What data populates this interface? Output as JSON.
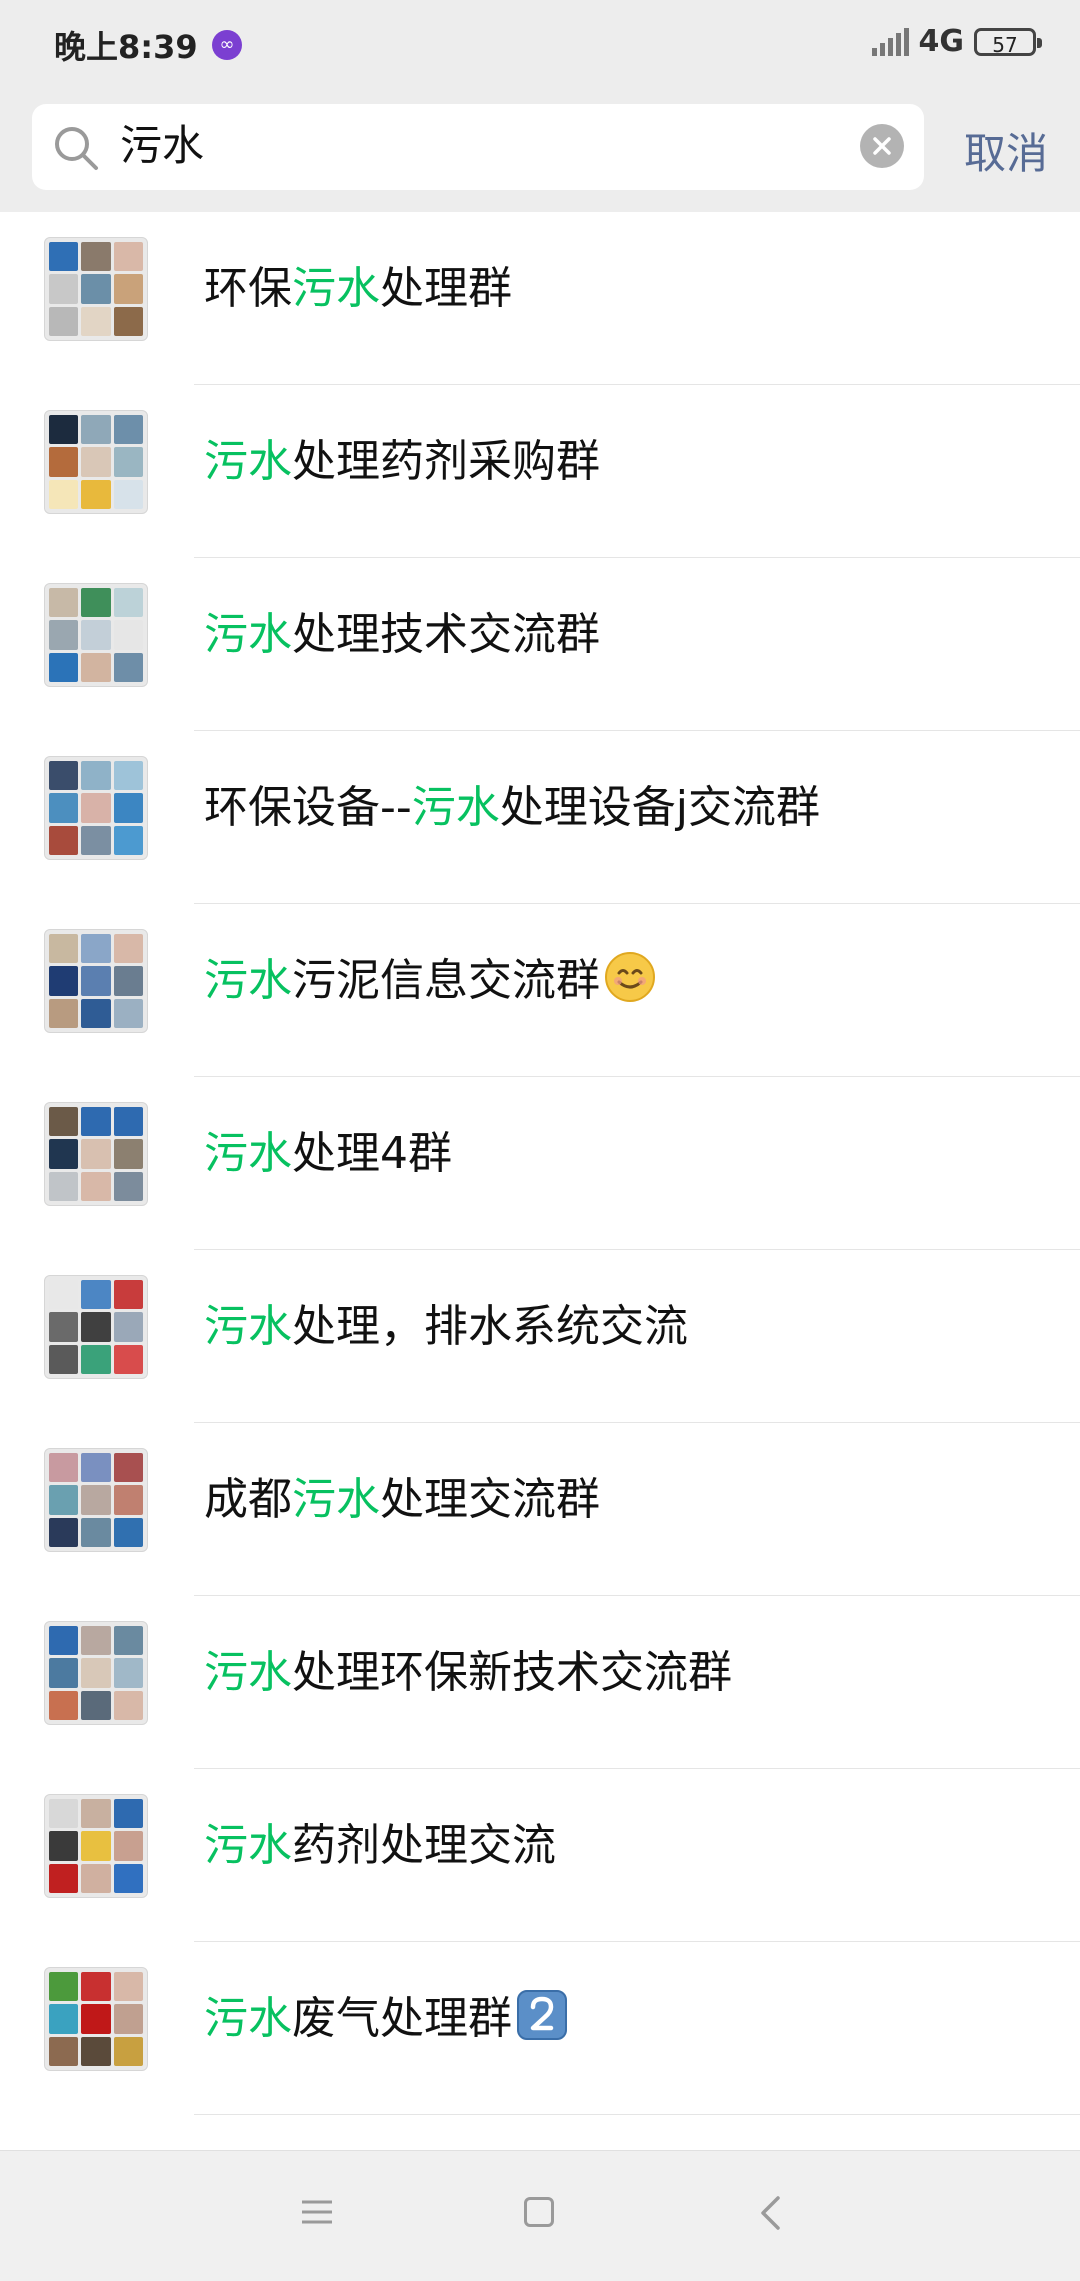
{
  "status_bar": {
    "time": "晚上8:39",
    "app_icon": "infinity-icon",
    "network": "4G",
    "battery": "57"
  },
  "search": {
    "query": "污水",
    "cancel_label": "取消"
  },
  "results": [
    {
      "pre": "环保",
      "match": "污水",
      "post": "处理群",
      "emoji": ""
    },
    {
      "pre": "",
      "match": "污水",
      "post": "处理药剂采购群",
      "emoji": ""
    },
    {
      "pre": "",
      "match": "污水",
      "post": "处理技术交流群",
      "emoji": ""
    },
    {
      "pre": "环保设备--",
      "match": "污水",
      "post": "处理设备j交流群",
      "emoji": ""
    },
    {
      "pre": "",
      "match": "污水",
      "post": "污泥信息交流群",
      "emoji": "smiling-face-emoji"
    },
    {
      "pre": "",
      "match": "污水",
      "post": "处理4群",
      "emoji": ""
    },
    {
      "pre": "",
      "match": "污水",
      "post": "处理，排水系统交流",
      "emoji": ""
    },
    {
      "pre": "成都",
      "match": "污水",
      "post": "处理交流群",
      "emoji": ""
    },
    {
      "pre": "",
      "match": "污水",
      "post": "处理环保新技术交流群",
      "emoji": ""
    },
    {
      "pre": "",
      "match": "污水",
      "post": "药剂处理交流",
      "emoji": ""
    },
    {
      "pre": "",
      "match": "污水",
      "post": "废气处理群",
      "emoji": "keycap-2-emoji"
    }
  ],
  "colors": {
    "highlight": "#07c160",
    "cancel": "#576b95",
    "header_bg": "#ededed"
  }
}
